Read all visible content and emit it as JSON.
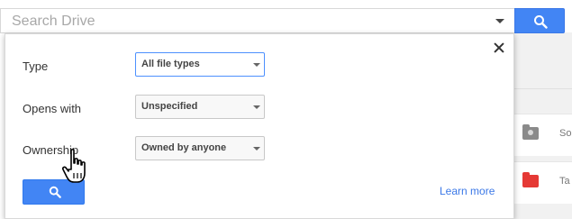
{
  "search": {
    "placeholder": "Search Drive",
    "button_icon": "search-icon",
    "dropdown_icon": "caret-down-icon"
  },
  "advanced": {
    "close_icon": "close-icon",
    "fields": [
      {
        "label": "Type",
        "value": "All file types"
      },
      {
        "label": "Opens with",
        "value": "Unspecified"
      },
      {
        "label": "Ownership",
        "value": "Owned by anyone"
      }
    ],
    "submit_icon": "search-icon",
    "learn_more": "Learn more"
  },
  "background_rows": [
    {
      "icon": "shared-folder-icon",
      "text": "So"
    },
    {
      "icon": "folder-icon",
      "text": "Ta"
    }
  ],
  "colors": {
    "accent": "#4285f4",
    "link": "#3b78e7",
    "folder_red": "#e53935"
  }
}
